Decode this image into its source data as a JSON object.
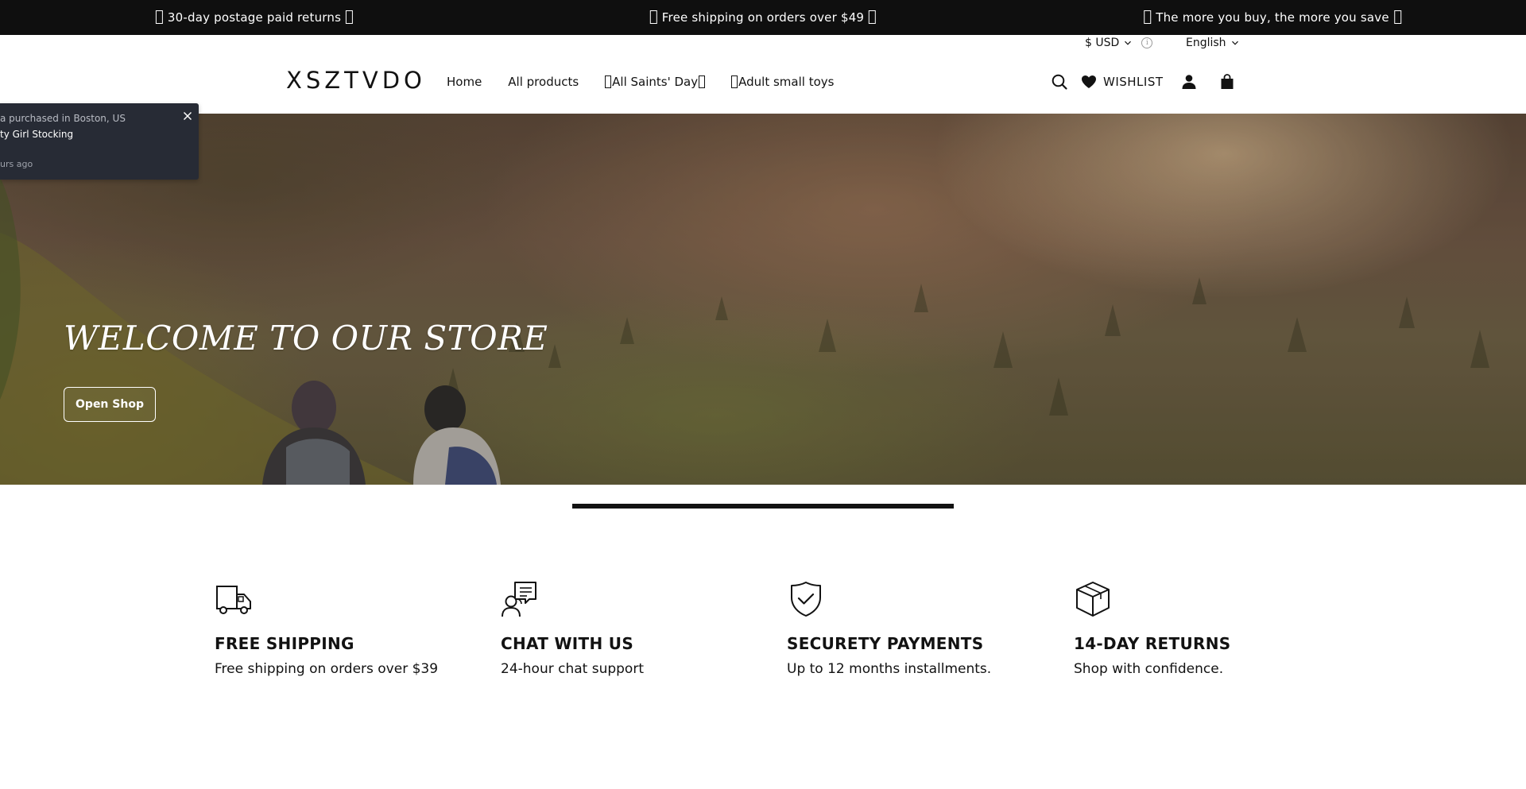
{
  "announcement": {
    "items": [
      {
        "text": "30-day postage paid returns"
      },
      {
        "text": "Free shipping on orders over $49"
      },
      {
        "text": "The more you buy, the more you save"
      }
    ]
  },
  "utility": {
    "currency": "$ USD",
    "language": "English"
  },
  "header": {
    "logo": "XSZTVDO",
    "nav": [
      {
        "label": "Home"
      },
      {
        "label": "All products"
      },
      {
        "label": "All Saints' Day"
      },
      {
        "label": "Adult small toys"
      }
    ],
    "wishlist_label": "WISHLIST",
    "icons": [
      "search-icon",
      "heart-icon",
      "account-icon",
      "cart-icon"
    ]
  },
  "hero": {
    "title": "WELCOME TO OUR STORE",
    "button_label": "Open Shop"
  },
  "toast": {
    "line1": "a purchased in Boston, US",
    "line2": "ty Girl Stocking",
    "line3": "urs ago"
  },
  "features": [
    {
      "icon": "truck-icon",
      "title": "FREE SHIPPING",
      "text": "Free shipping on orders over $39"
    },
    {
      "icon": "chat-support-icon",
      "title": "CHAT WITH US",
      "text": "24-hour chat support"
    },
    {
      "icon": "shield-check-icon",
      "title": "SECURETY PAYMENTS",
      "text": "Up to 12 months installments."
    },
    {
      "icon": "box-icon",
      "title": "14-DAY RETURNS",
      "text": "Shop with confidence."
    }
  ],
  "colors": {
    "announcement_bg": "#0f0f0f",
    "text": "#121212",
    "toast_bg": "#272b35"
  }
}
